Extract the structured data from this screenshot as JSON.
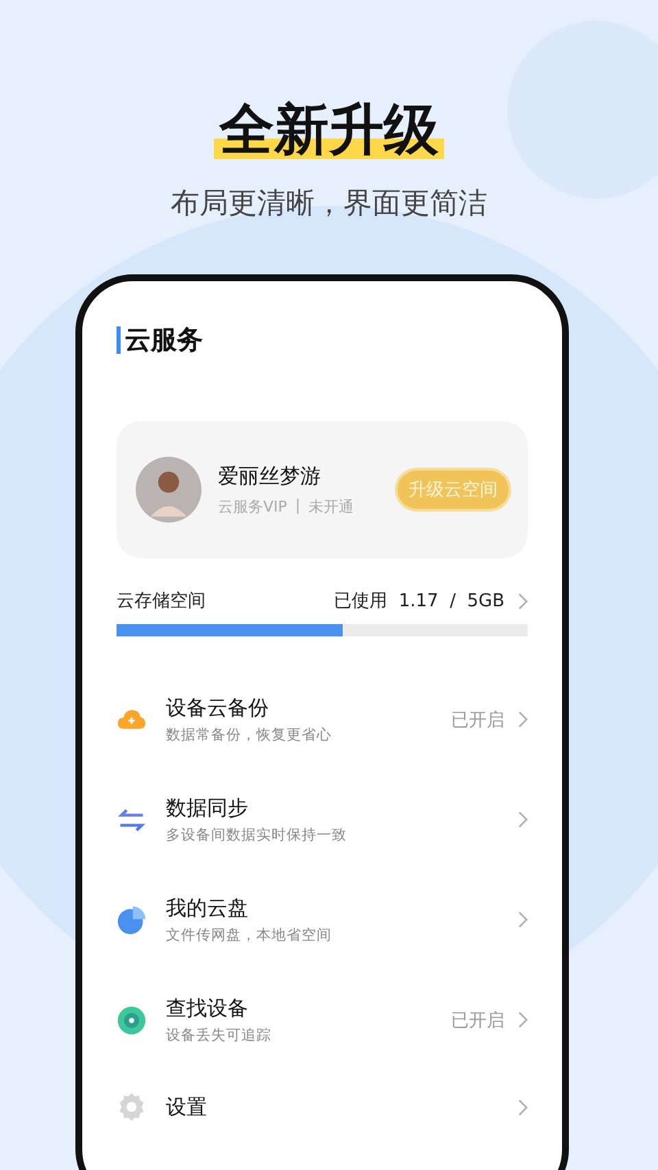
{
  "headline": "全新升级",
  "subtitle": "布局更清晰，界面更简洁",
  "screen": {
    "title": "云服务",
    "profile": {
      "name": "爱丽丝梦游",
      "membership": "云服务VIP",
      "separator": "|",
      "status": "未开通",
      "upgrade_button": "升级云空间"
    },
    "storage": {
      "label": "云存储空间",
      "usage": "已使用  1.17  /  5GB",
      "level": 0.55
    },
    "items": [
      {
        "kind": "cloud",
        "title": "设备云备份",
        "subtitle": "数据常备份，恢复更省心",
        "status": "已开启"
      },
      {
        "kind": "sync",
        "title": "数据同步",
        "subtitle": "多设备间数据实时保持一致"
      },
      {
        "kind": "disk",
        "title": "我的云盘",
        "subtitle": "文件传网盘，本地省空间"
      },
      {
        "kind": "locate",
        "title": "查找设备",
        "subtitle": "设备丢失可追踪",
        "status": "已开启"
      },
      {
        "kind": "settings",
        "title": "设置"
      }
    ]
  }
}
